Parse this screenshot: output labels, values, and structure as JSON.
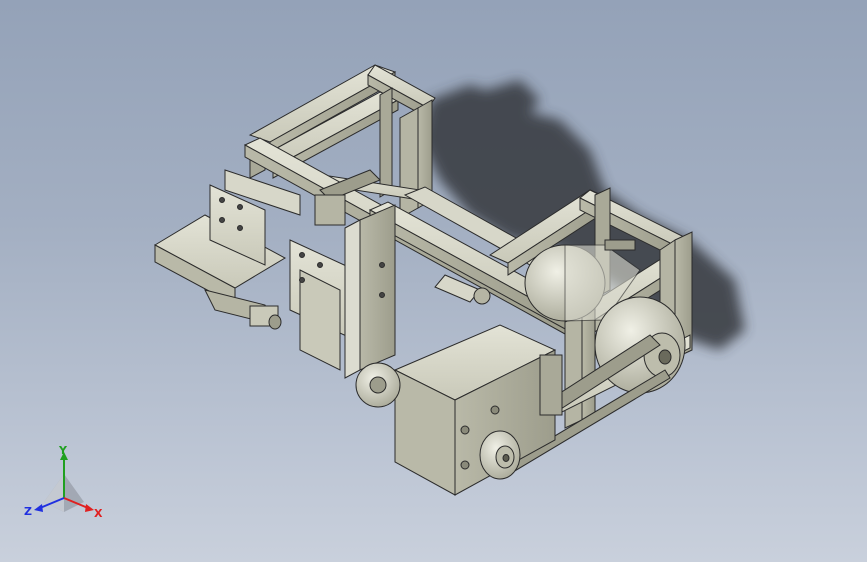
{
  "viewport": {
    "background_top": "#94a2b8",
    "background_bottom": "#c9d0dc"
  },
  "model": {
    "part_color": "#c8c8b8",
    "shadow_color": "#3a3d44",
    "edge_color": "#2b2b2b"
  },
  "triad": {
    "x_label": "X",
    "y_label": "Y",
    "z_label": "Z",
    "x_color": "#e02020",
    "y_color": "#20a020",
    "z_color": "#2030e0"
  }
}
